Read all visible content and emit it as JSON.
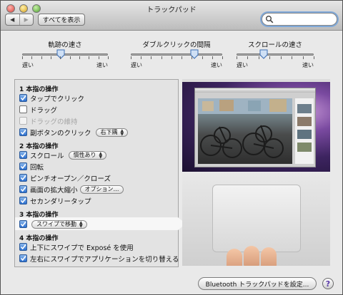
{
  "window": {
    "title": "トラックパッド"
  },
  "toolbar": {
    "back_symbol": "◀",
    "forward_symbol": "▶",
    "show_all_label": "すべてを表示",
    "search_value": "",
    "search_placeholder": ""
  },
  "sliders": [
    {
      "label": "軌跡の速さ",
      "min_label": "遅い",
      "max_label": "速い",
      "level": 0.45,
      "ticks": 10
    },
    {
      "label": "ダブルクリックの間隔",
      "min_label": "遅い",
      "max_label": "速い",
      "level": 0.7,
      "ticks": 10
    },
    {
      "label": "スクロールの速さ",
      "min_label": "遅い",
      "max_label": "速い",
      "level": 0.35,
      "ticks": 8
    }
  ],
  "options": {
    "one_finger": {
      "title": "1 本指の操作",
      "tap_to_click": "タップでクリック",
      "drag": "ドラッグ",
      "drag_lock": "ドラッグの維持",
      "secondary_click": "副ボタンのクリック",
      "secondary_click_popup": "右下隅"
    },
    "two_finger": {
      "title": "2 本指の操作",
      "scroll": "スクロール",
      "scroll_popup": "慣性あり",
      "rotate": "回転",
      "pinch": "ピンチオープン／クローズ",
      "zoom": "画面の拡大縮小",
      "zoom_button": "オプション…",
      "secondary_tap": "セカンダリータップ"
    },
    "three_finger": {
      "title": "3 本指の操作",
      "swipe_popup": "スワイプで移動"
    },
    "four_finger": {
      "title": "4 本指の操作",
      "expose": "上下にスワイプで Exposé を使用",
      "app_switch": "左右にスワイプでアプリケーションを切り替える"
    }
  },
  "bottom": {
    "bluetooth_button": "Bluetooth トラックパッドを設定...",
    "help_symbol": "?"
  },
  "colors": {
    "checkbox_blue": "#2b6fcf",
    "focus_ring": "#7fa8d8"
  }
}
